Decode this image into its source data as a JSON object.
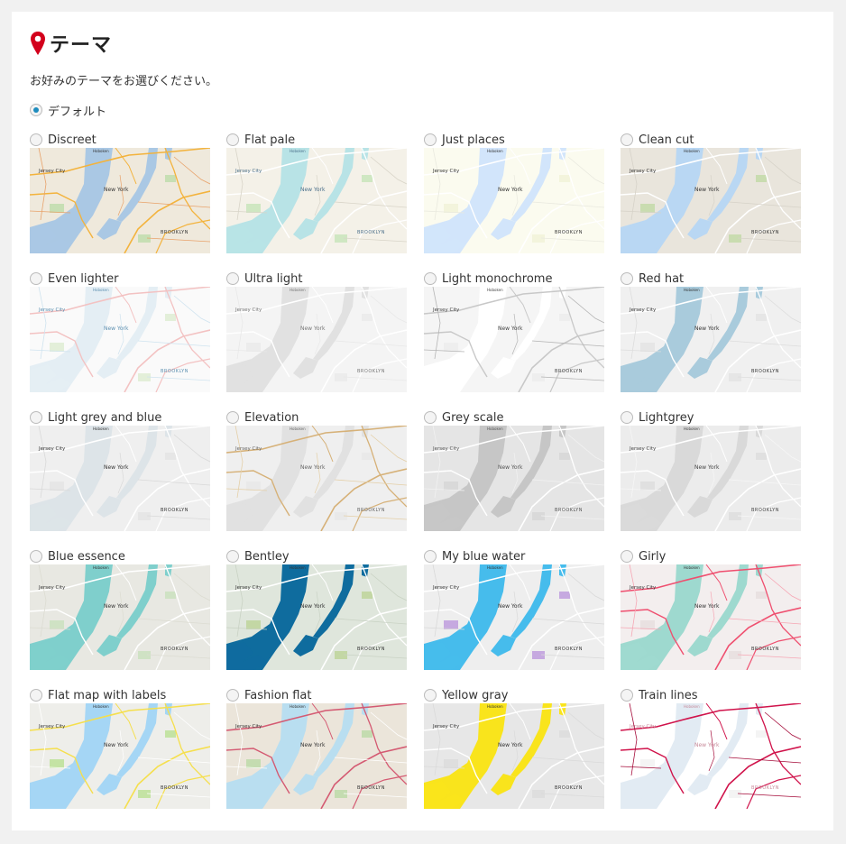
{
  "section": {
    "title": "テーマ",
    "description": "お好みのテーマをお選びください。",
    "default_label": "デフォルト"
  },
  "map_labels": {
    "jersey": "Jersey City",
    "newyork": "New York",
    "brooklyn": "BROOKLYN",
    "hoboken": "Hoboken"
  },
  "themes": [
    {
      "label": "Discreet",
      "colors": {
        "bg": "#efe9dc",
        "water": "#aac8e4",
        "road": "#f3b33d",
        "road2": "#e8a26a",
        "park": "#c7dfb4",
        "text": "#333333"
      }
    },
    {
      "label": "Flat pale",
      "colors": {
        "bg": "#f4f1e8",
        "water": "#b8e3e6",
        "road": "#ffffff",
        "road2": "#d8d4c8",
        "park": "#cfe7c2",
        "text": "#4a6f8a"
      }
    },
    {
      "label": "Just places",
      "colors": {
        "bg": "#fbfbef",
        "water": "#d2e5fb",
        "road": "#ffffff",
        "road2": "#e9e9df",
        "park": "#f3f4dc",
        "text": "#333333"
      }
    },
    {
      "label": "Clean cut",
      "colors": {
        "bg": "#e9e5dc",
        "water": "#b9d7f3",
        "road": "#ffffff",
        "road2": "#d6d2c8",
        "park": "#c9dcb0",
        "text": "#333333"
      }
    },
    {
      "label": "Even lighter",
      "colors": {
        "bg": "#fafafa",
        "water": "#e4eef4",
        "road": "#f3c2c2",
        "road2": "#cfe3ef",
        "park": "#e3efd9",
        "text": "#5b8fb0"
      }
    },
    {
      "label": "Ultra light",
      "colors": {
        "bg": "#f4f4f4",
        "water": "#e1e1e1",
        "road": "#ffffff",
        "road2": "#e8e8e8",
        "park": "#ececec",
        "text": "#777777"
      }
    },
    {
      "label": "Light monochrome",
      "colors": {
        "bg": "#f5f5f5",
        "water": "#ffffff",
        "road": "#c8c8c8",
        "road2": "#b5b5b5",
        "park": "#eeeeee",
        "text": "#444444"
      }
    },
    {
      "label": "Red hat",
      "colors": {
        "bg": "#f0f0f0",
        "water": "#a9cbdc",
        "road": "#ffffff",
        "road2": "#dddddd",
        "park": "#e6e6e6",
        "text": "#333333"
      }
    },
    {
      "label": "Light grey and blue",
      "colors": {
        "bg": "#efefef",
        "water": "#dde4e8",
        "road": "#ffffff",
        "road2": "#d9d9d9",
        "park": "#e6e6e6",
        "text": "#333333"
      }
    },
    {
      "label": "Elevation",
      "colors": {
        "bg": "#efefef",
        "water": "#e1e1e1",
        "road": "#d6b178",
        "road2": "#e4cfa7",
        "park": "#e9e9e9",
        "text": "#666666"
      }
    },
    {
      "label": "Grey scale",
      "colors": {
        "bg": "#e5e5e5",
        "water": "#c6c6c6",
        "road": "#ffffff",
        "road2": "#f2f2f2",
        "park": "#d9d9d9",
        "text": "#555555"
      }
    },
    {
      "label": "Lightgrey",
      "colors": {
        "bg": "#ececec",
        "water": "#d9d9d9",
        "road": "#ffffff",
        "road2": "#f6f6f6",
        "park": "#e0e0e0",
        "text": "#444444"
      }
    },
    {
      "label": "Blue essence",
      "colors": {
        "bg": "#e8e8e2",
        "water": "#7fcfcc",
        "road": "#ffffff",
        "road2": "#dcdcd2",
        "park": "#cfe2c4",
        "text": "#333333"
      }
    },
    {
      "label": "Bentley",
      "colors": {
        "bg": "#dfe6dc",
        "water": "#0f6c9e",
        "road": "#ffffff",
        "road2": "#c9d2c4",
        "park": "#c3d7a4",
        "text": "#333333"
      }
    },
    {
      "label": "My blue water",
      "colors": {
        "bg": "#eeeeee",
        "water": "#46bcec",
        "road": "#ffffff",
        "road2": "#d9d9d9",
        "park": "#c6a9e0",
        "text": "#333333"
      }
    },
    {
      "label": "Girly",
      "colors": {
        "bg": "#f3eeee",
        "water": "#9ed9cf",
        "road": "#ef4f6f",
        "road2": "#f6a6b4",
        "park": "#e9e1e1",
        "text": "#333333"
      }
    },
    {
      "label": "Flat map with labels",
      "colors": {
        "bg": "#eeeeea",
        "water": "#a5d6f5",
        "road": "#f5df4d",
        "road2": "#ffffff",
        "park": "#c4e3a4",
        "text": "#333333"
      }
    },
    {
      "label": "Fashion flat",
      "colors": {
        "bg": "#ebe5da",
        "water": "#b9def0",
        "road": "#d45a72",
        "road2": "#ffffff",
        "park": "#c4dcb0",
        "text": "#333333"
      }
    },
    {
      "label": "Yellow gray",
      "colors": {
        "bg": "#e7e7e7",
        "water": "#f9e41c",
        "road": "#ffffff",
        "road2": "#dadada",
        "park": "#dedede",
        "text": "#333333"
      }
    },
    {
      "label": "Train lines",
      "colors": {
        "bg": "#ffffff",
        "water": "#e2ebf3",
        "road": "#d0134b",
        "road2": "#a50c3a",
        "park": "#f4f4f4",
        "text": "#c88a9a"
      }
    }
  ],
  "colors": {
    "page_bg": "#f1f1f1",
    "card_bg": "#ffffff",
    "radio_selected": "#1e8cbe",
    "pin": "#d3001c"
  }
}
